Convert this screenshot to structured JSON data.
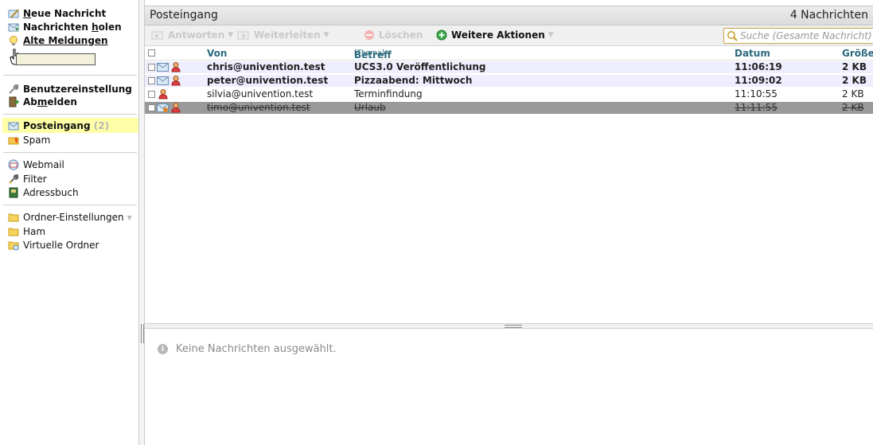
{
  "sidebar": {
    "new_message": {
      "u": "N",
      "rest": "eue Nachricht"
    },
    "fetch": {
      "pre": "Nachrichten ",
      "u": "h",
      "post": "olen"
    },
    "old_messages": "Alte Meldungen",
    "settings": "Benutzereinstellung",
    "logout": {
      "pre": "Ab",
      "u": "m",
      "post": "elden"
    },
    "inbox": {
      "label": "Posteingang",
      "count": "(2)"
    },
    "spam": "Spam",
    "webmail": "Webmail",
    "filter": "Filter",
    "addressbook": "Adressbuch",
    "folder_settings": "Ordner-Einstellungen",
    "ham": "Ham",
    "virtual_folders": "Virtuelle Ordner"
  },
  "header": {
    "title": "Posteingang",
    "count": "4 Nachrichten"
  },
  "toolbar": {
    "reply": "Antworten",
    "forward": "Weiterleiten",
    "delete": "Löschen",
    "more": "Weitere Aktionen",
    "search_placeholder": "Suche (Gesamte Nachricht)"
  },
  "columns": {
    "from": "Von",
    "subject": "Betreff",
    "thread": "[Thema]",
    "date": "Datum",
    "size": "Größe"
  },
  "messages": [
    {
      "from": "chris@univention.test",
      "subject": "UCS3.0 Veröffentlichung",
      "date": "11:06:19",
      "size": "2 KB"
    },
    {
      "from": "peter@univention.test",
      "subject": "Pizzaabend: Mittwoch",
      "date": "11:09:02",
      "size": "2 KB"
    },
    {
      "from": "silvia@univention.test",
      "subject": "Terminfindung",
      "date": "11:10:55",
      "size": "2 KB"
    },
    {
      "from": "timo@univention.test",
      "subject": "Urlaub",
      "date": "11:11:55",
      "size": "2 KB"
    }
  ],
  "preview": {
    "empty_text": "Keine Nachrichten ausgewählt."
  },
  "colors": {
    "accent": "#2b6a7d",
    "active_folder": "#ffffa8",
    "unread_row": "#eeeeff",
    "deleted_row": "#9a9a9a"
  }
}
